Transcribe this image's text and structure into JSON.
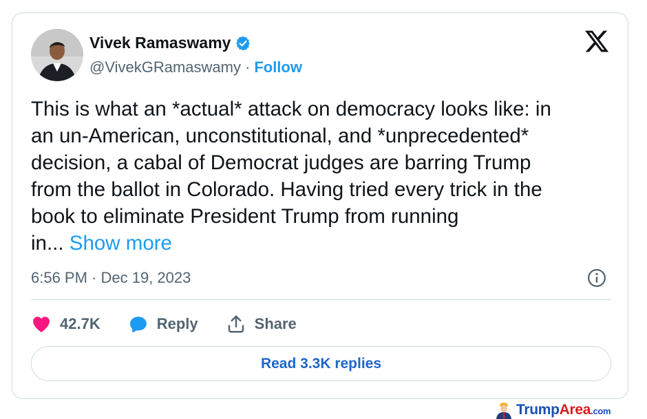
{
  "user": {
    "name": "Vivek Ramaswamy",
    "handle": "@VivekGRamaswamy",
    "separator": "·",
    "follow_label": "Follow"
  },
  "tweet": {
    "text": "This is what an *actual* attack on democracy looks like: in\nan un-American, unconstitutional, and *unprecedented*\ndecision, a cabal of Democrat judges are barring Trump\nfrom the ballot in Colorado. Having tried every trick in the\nbook to eliminate President Trump from running\nin...",
    "show_more_label": "Show more",
    "timestamp": "6:56 PM · Dec 19, 2023"
  },
  "actions": {
    "likes_count": "42.7K",
    "reply_label": "Reply",
    "share_label": "Share"
  },
  "read_replies_label": "Read 3.3K replies",
  "watermark": {
    "part1": "Trump",
    "part2": "Area",
    "part3": ".com"
  },
  "icons": {
    "verified": "verified-badge-icon",
    "logo": "x-logo-icon",
    "info": "info-icon",
    "like": "heart-icon",
    "reply": "speech-bubble-icon",
    "share": "share-upload-icon"
  },
  "colors": {
    "accent_blue": "#1d9bf0",
    "like_pink": "#f91880",
    "text_primary": "#0f1419",
    "text_secondary": "#536471",
    "border": "#cfd9de"
  }
}
